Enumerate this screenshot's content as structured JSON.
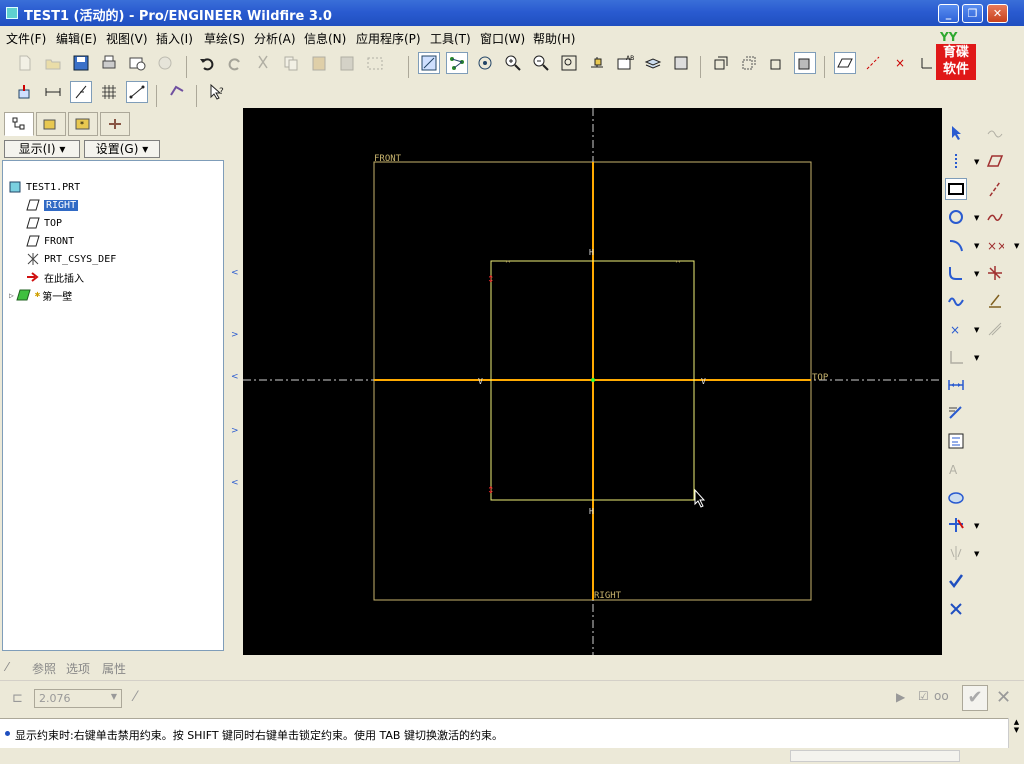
{
  "window": {
    "title": "TEST1 (活动的) - Pro/ENGINEER Wildfire 3.0"
  },
  "menu": [
    "文件(F)",
    "编辑(E)",
    "视图(V)",
    "插入(I)",
    "草绘(S)",
    "分析(A)",
    "信息(N)",
    "应用程序(P)",
    "工具(T)",
    "窗口(W)",
    "帮助(H)"
  ],
  "logo": {
    "top": "YY",
    "line1": "育碟",
    "line2": "软件"
  },
  "model_tree": {
    "display_label": "显示(I) ▾",
    "settings_label": "设置(G) ▾",
    "items": [
      {
        "label": "TEST1.PRT",
        "icon": "part-icon"
      },
      {
        "label": "RIGHT",
        "icon": "datum-plane-icon",
        "selected": true
      },
      {
        "label": "TOP",
        "icon": "datum-plane-icon"
      },
      {
        "label": "FRONT",
        "icon": "datum-plane-icon"
      },
      {
        "label": "PRT_CSYS_DEF",
        "icon": "csys-icon"
      },
      {
        "label": "在此插入",
        "icon": "insert-here-arrow-icon"
      },
      {
        "label": "第一壁",
        "icon": "wall-feature-icon"
      }
    ]
  },
  "canvas": {
    "labels": {
      "front": "FRONT",
      "top": "TOP",
      "right": "RIGHT"
    },
    "colors": {
      "background": "#000000",
      "datum": "#c8b46e",
      "sketch": "#f0f078",
      "axis": "#ffaa00",
      "constraint": "#ff3030",
      "origin": "#30ff30"
    }
  },
  "dashboard": {
    "tabs": [
      "参照",
      "选项",
      "属性"
    ],
    "value": "2.076"
  },
  "status": {
    "message": "显示约束时:右键单击禁用约束。按 SHIFT 键同时右键单击锁定约束。使用 TAB 键切换激活的约束。"
  }
}
